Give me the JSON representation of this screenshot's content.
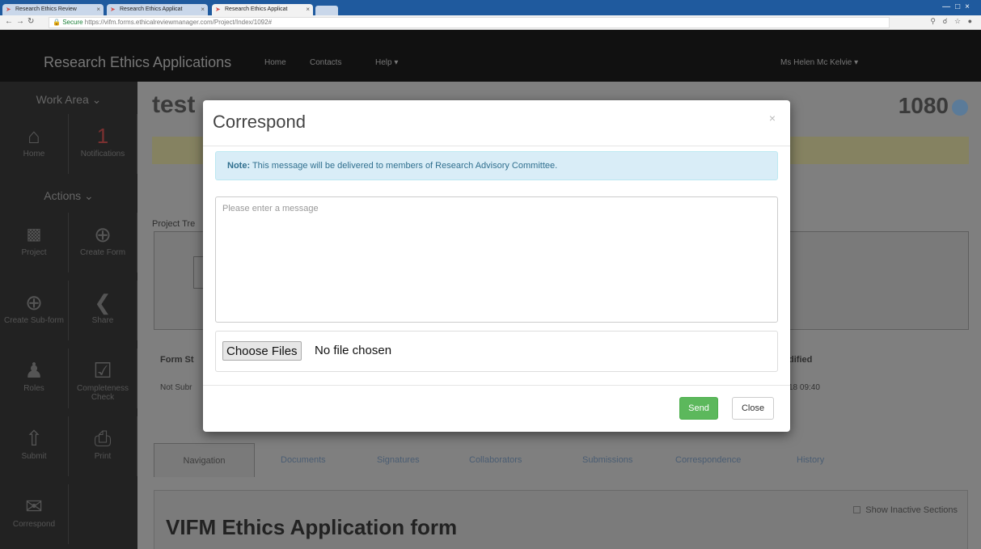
{
  "browser": {
    "tabs": [
      {
        "label": "Research Ethics Review"
      },
      {
        "label": "Research Ethics Applicat"
      },
      {
        "label": "Research Ethics Applicat"
      }
    ],
    "url_secure": "Secure",
    "url": "https://vifm.forms.ethicalreviewmanager.com/Project/Index/1092#"
  },
  "navbar": {
    "brand": "Research Ethics Applications",
    "links": [
      "Home",
      "Contacts",
      "Help ▾"
    ],
    "user": "Ms Helen Mc Kelvie ▾"
  },
  "sidebar": {
    "work_area": "Work Area ⌄",
    "actions": "Actions ⌄",
    "notification_count": "1",
    "tiles": [
      {
        "label": "Home"
      },
      {
        "label": "Notifications"
      },
      {
        "label": "Project"
      },
      {
        "label": "Create Form"
      },
      {
        "label": "Create Sub-form"
      },
      {
        "label": "Share"
      },
      {
        "label": "Roles"
      },
      {
        "label": "Completeness Check"
      },
      {
        "label": "Submit"
      },
      {
        "label": "Print"
      },
      {
        "label": "Correspond"
      }
    ]
  },
  "page": {
    "title": "test",
    "number": "1080",
    "project_tree": "Project Tre",
    "form_status_header": "Form St",
    "form_status_value": "Not Subr",
    "modified_header": "dified",
    "modified_value": "18 09:40",
    "tabs": [
      "Navigation",
      "Documents",
      "Signatures",
      "Collaborators",
      "Submissions",
      "Correspondence",
      "History"
    ],
    "form_heading": "VIFM Ethics Application form",
    "show_inactive": "Show Inactive Sections"
  },
  "modal": {
    "title": "Correspond",
    "close_x": "×",
    "note_label": "Note:",
    "note_text": " This message will be delivered to members of Research Advisory Committee.",
    "message_placeholder": "Please enter a message",
    "choose_files": "Choose Files",
    "no_file": "No file chosen",
    "send": "Send",
    "close": "Close"
  }
}
